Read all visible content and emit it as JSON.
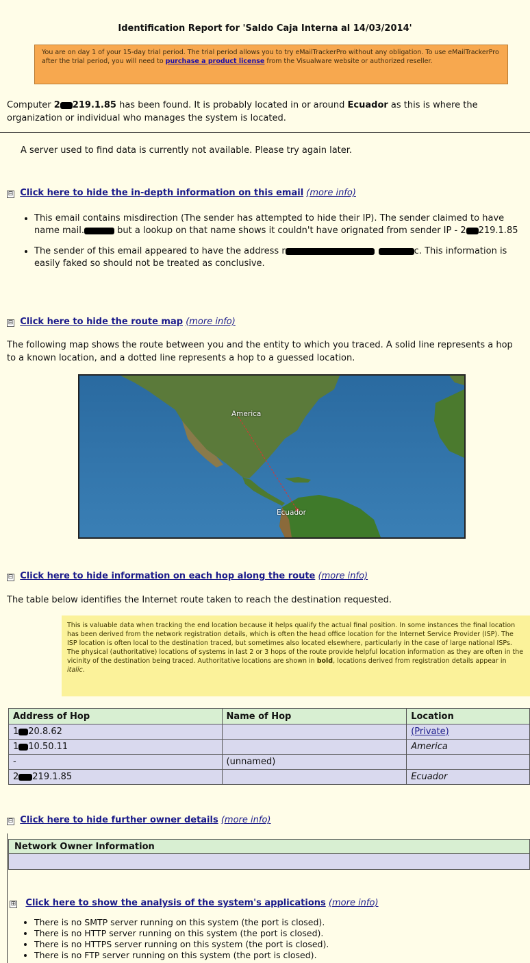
{
  "report": {
    "title": "Identification Report for 'Saldo Caja Interna al 14/03/2014'"
  },
  "trial_notice": {
    "text_before_link": "You are on day 1 of your 15-day trial period. The trial period allows you to try eMailTrackerPro without any obligation. To use eMailTrackerPro after the trial period, you will need to ",
    "link_text": "purchase a product license",
    "text_after_link": " from the Visualware website or authorized reseller."
  },
  "found": {
    "prefix": "Computer ",
    "ip_visible": "219.1.85",
    "middle": " has been found. It is probably located in or around ",
    "country": "Ecuador",
    "suffix": " as this is where the organization or individual who manages the system is located."
  },
  "server_notice": "A server used to find data is currently not available. Please try again later.",
  "sections": {
    "email": {
      "toggle": "⊟",
      "link": "Click here to hide the in-depth information on this email",
      "more": "(more info)",
      "bullets": [
        {
          "part1": "This email contains misdirection (The sender has attempted to hide their IP). The sender claimed to have name mail.",
          "part2": " but a lookup on that name shows it couldn't have orignated from sender IP - ",
          "ip": "219.1.85"
        },
        {
          "part1": "The sender of this email appeared to have the address ",
          "part2": "c. This information is easily faked so should not be treated as conclusive."
        }
      ]
    },
    "route_map": {
      "toggle": "⊟",
      "link": "Click here to hide the route map",
      "more": "(more info)",
      "description": "The following map shows the route between you and the entity to which you traced. A solid line represents a hop to a known location, and a dotted line represents a hop to a guessed location.",
      "labels": {
        "america": "America",
        "ecuador": "Ecuador"
      }
    },
    "hops": {
      "toggle": "⊟",
      "link": "Click here to hide information on each hop along the route",
      "more": "(more info)",
      "description": "The table below identifies the Internet route taken to reach the destination requested.",
      "note": {
        "part1": "This is valuable data when tracking the end location because it helps qualify the actual final position. In some instances the final location has been derived from the network registration details, which is often the head office location for the Internet Service Provider (ISP). The ISP location is often local to the destination traced, but sometimes also located elsewhere, particularly in the case of large national ISPs. The physical (authoritative) locations of systems in last 2 or 3 hops of the route provide helpful location information as they are often in the vicinity of the destination being traced. Authoritative locations are shown in ",
        "bold": "bold",
        "part2": ", locations derived from registration details appear in ",
        "italic": "italic",
        "part3": "."
      },
      "columns": [
        "Address of Hop",
        "Name of Hop",
        "Location"
      ],
      "rows": [
        {
          "address_prefix": "1",
          "address": "20.8.62",
          "name": "",
          "location": "(Private)",
          "location_style": "link"
        },
        {
          "address_prefix": "1",
          "address": "10.50.11",
          "name": "",
          "location": "America",
          "location_style": "italic"
        },
        {
          "address_prefix": "",
          "address": "-",
          "name": "(unnamed)",
          "location": "",
          "location_style": "plain"
        },
        {
          "address_prefix": "2",
          "address": "219.1.85",
          "name": "",
          "location": "Ecuador",
          "location_style": "italic"
        }
      ]
    },
    "owner": {
      "toggle": "⊟",
      "link": "Click here to hide further owner details",
      "more": "(more info)",
      "table_header": "Network Owner Information"
    },
    "applications": {
      "toggle": "⊞",
      "link": "Click here to show the analysis of the system's applications",
      "more": "(more info)",
      "items": [
        "There is no SMTP server running on this system (the port is closed).",
        "There is no HTTP server running on this system (the port is closed).",
        "There is no HTTPS server running on this system (the port is closed).",
        "There is no FTP server running on this system (the port is closed)."
      ]
    }
  },
  "colors": {
    "background": "#fffde8",
    "trial_bg": "#f7a84f",
    "note_bg": "#fbf29a",
    "table_header_bg": "#d8efd2",
    "table_row_bg": "#d9d9ee",
    "link": "#1a1a8a"
  }
}
